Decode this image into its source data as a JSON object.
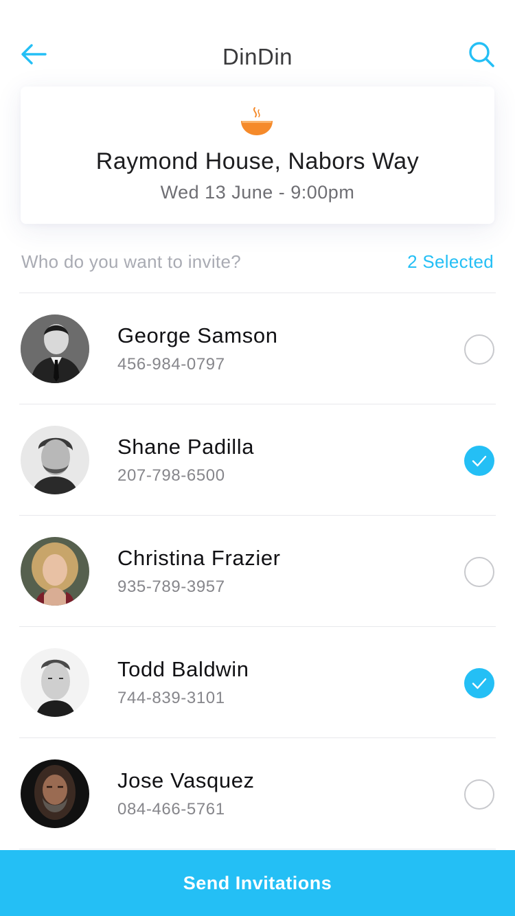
{
  "header": {
    "title": "DinDin",
    "back_icon": "arrow-left-icon",
    "search_icon": "search-icon"
  },
  "event": {
    "icon": "food-bowl-icon",
    "venue": "Raymond House, Nabors Way",
    "date": "Wed 13 June - 9:00pm"
  },
  "invite": {
    "prompt": "Who do you want to invite?",
    "selected_label": "2 Selected"
  },
  "contacts": [
    {
      "name": "George Samson",
      "phone": "456-984-0797",
      "selected": false
    },
    {
      "name": "Shane Padilla",
      "phone": "207-798-6500",
      "selected": true
    },
    {
      "name": "Christina Frazier",
      "phone": "935-789-3957",
      "selected": false
    },
    {
      "name": "Todd Baldwin",
      "phone": "744-839-3101",
      "selected": true
    },
    {
      "name": "Jose Vasquez",
      "phone": "084-466-5761",
      "selected": false
    }
  ],
  "footer": {
    "send_label": "Send Invitations"
  },
  "colors": {
    "accent": "#24bff5",
    "bowl": "#f58a2a"
  }
}
